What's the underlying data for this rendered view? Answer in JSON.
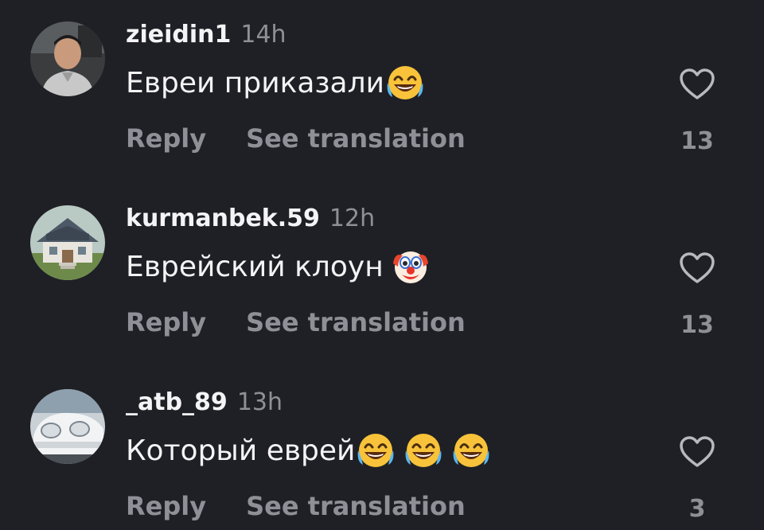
{
  "comments": [
    {
      "username": "zieidin1",
      "time": "14h",
      "text": "Евреи приказали",
      "emojis": [
        "😂"
      ],
      "emoji_names": [
        "face-with-tears-of-joy-icon"
      ],
      "reply_label": "Reply",
      "translate_label": "See translation",
      "like_count": "13",
      "avatar": "man-in-car-avatar"
    },
    {
      "username": "kurmanbek.59",
      "time": "12h",
      "text": "Еврейский клоун ",
      "emojis": [
        "🤡"
      ],
      "emoji_names": [
        "clown-face-icon"
      ],
      "reply_label": "Reply",
      "translate_label": "See translation",
      "like_count": "13",
      "avatar": "house-avatar"
    },
    {
      "username": "_atb_89",
      "time": "13h",
      "text": "Который еврей",
      "emojis": [
        "😂",
        "😂",
        "😂"
      ],
      "emoji_names": [
        "face-with-tears-of-joy-icon",
        "face-with-tears-of-joy-icon",
        "face-with-tears-of-joy-icon"
      ],
      "reply_label": "Reply",
      "translate_label": "See translation",
      "like_count": "3",
      "avatar": "white-car-avatar"
    }
  ],
  "colors": {
    "background": "#1f2025",
    "primary_text": "#f4f4f6",
    "secondary_text": "#8f9097"
  }
}
